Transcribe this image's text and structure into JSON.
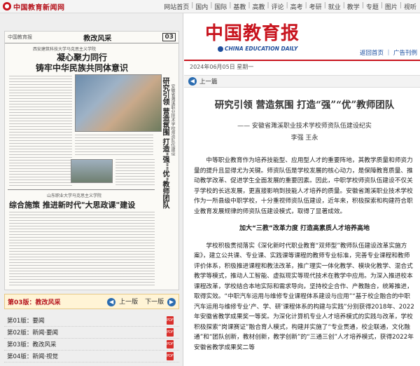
{
  "site": {
    "logo_text": "中国教育新闻网",
    "nav": [
      "网站首页",
      "国内",
      "国际",
      "基教",
      "高教",
      "评论",
      "高考",
      "考研",
      "就业",
      "教学",
      "专题",
      "图片",
      "视听"
    ]
  },
  "paper": {
    "brand": "中国教育报",
    "section": "教改风采",
    "page_no": "03",
    "art1_kicker": "西安建筑科技大学马克思主义学院",
    "art1_title_line1": "凝心聚力同行",
    "art1_title_line2": "铸牢中华民族共同体意识",
    "art2_kicker": "山东职业大学马克思主义学院",
    "art2_title": "综合施策 推进新时代\"大思政课\"建设",
    "vertical_title": "研究引领 营造氛围 打造\"强\"\"优\"教师团队",
    "vertical_sub": "安徽省濉溪职业技术学校师资队伍建设"
  },
  "pagebar": {
    "current": "第03版：教改风采",
    "prev": "上一版",
    "next": "下一版"
  },
  "pagelist": [
    {
      "label": "第01版：要闻"
    },
    {
      "label": "第02版：新闻·要闻"
    },
    {
      "label": "第03版：教改风采"
    },
    {
      "label": "第04版：新闻·视觉"
    }
  ],
  "masthead": {
    "cn_title": "中国教育报",
    "en_title": "CHINA EDUCATION DAILY",
    "link_home": "返回首页",
    "link_sep": "｜",
    "link_ad": "广告刊例"
  },
  "datebar": {
    "text": "2024年06月05日  星期一"
  },
  "toolbar": {
    "prev_article": "上一篇"
  },
  "article": {
    "title": "研究引领 营造氛围 打造“强”“优”教师团队",
    "subtitle": "——  安徽省濉溪职业技术学校师资队伍建设纪实",
    "authors": "李强  王永",
    "p1": "中等职业教育作为培养技能型、应用型人才的重要阵地，其教学质量和师资力量的提升且显得尤为关键。师资队伍是学校发展的核心动力，是保障教育质量、推动教学改革、促进学生全面发展的重要因素。因此，中职学校师资队伍建设不仅关乎学校的长远发展，更直接影响到技能人才培养的质量。安徽省濉溪职业技术学校作为一所县级中职学校，十分重视师资队伍建设，近年来，积极探索和构建符合职业教育发展规律的师资队伍建设模式，取得了显著成效。",
    "h1": "加大“三教”改革力度 打造高素质人才培养高地",
    "p2": "学校积极贯彻落实《深化新时代职业教育“双师型”教师队伍建设改革实施方案》，建立公共课、专业课、实践课等课程的教师专业标准，完善专业课程和教师评价体系，积极推进课程和教法改革，推广理实一体化教学、模块化教学、混合式教学等模式，推动人工智能、虚拟现实等现代技术在教学中应用。为深入推进校本课程改革，学校结合本地实际和需求导向，坚持校企合作、产教融合，统筹推进，取得实效。“中职汽车运用与维修专业课程体系建设与应用”“基于校企融合的中职汽车运用与维修专业‘产、学、研’课程体系的构建与实践”分别获得2018年、2022年安徽省教学成果奖一等奖。为深化计算机专业人才培养模式的实践与改革，学校积极探索“岗课赛证”融合育人模式，构建并实施了“专业贯通，校企联通，文化融通”和“团队创新，教材创新，教学创新”的“三通三创”人才培养模式，获得2022年安徽省教学成果奖二等"
  },
  "colors": {
    "brand_red": "#c8141e",
    "link_blue": "#1a4ea0",
    "page_highlight": "#fff4d6"
  }
}
